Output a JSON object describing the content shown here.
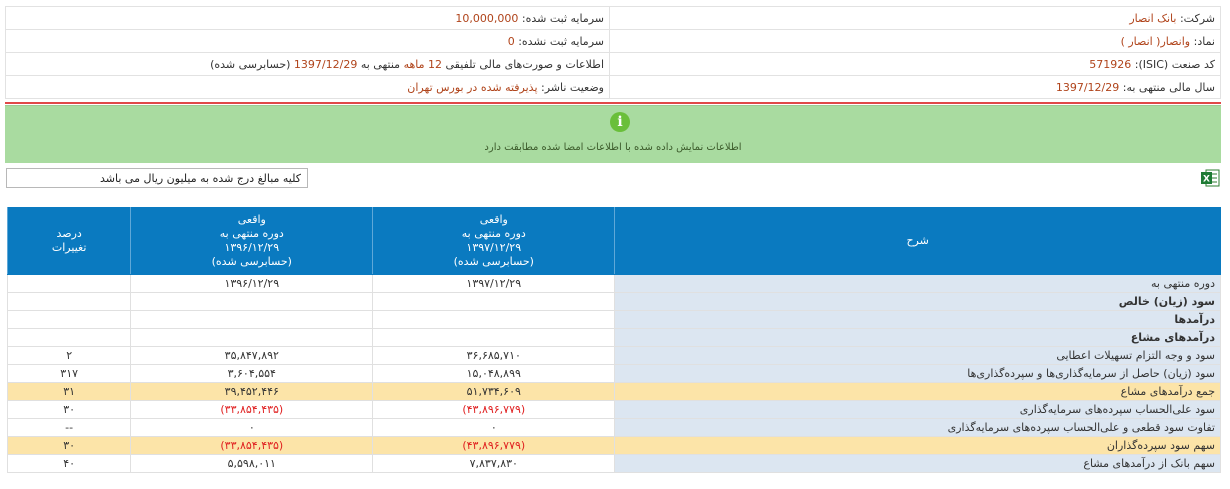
{
  "info": {
    "company_label": "شرکت:",
    "company_value": "بانک انصار",
    "capital_reg_label": "سرمایه ثبت شده:",
    "capital_reg_value": "10,000,000",
    "symbol_label": "نماد:",
    "symbol_value": "وانصار( انصار )",
    "capital_unreg_label": "سرمایه ثبت نشده:",
    "capital_unreg_value": "0",
    "isic_label": "کد صنعت (ISIC):",
    "isic_value": "571926",
    "report_label": "اطلاعات و صورت‌های مالی تلفیقی",
    "report_months": "12 ماهه",
    "report_mid": "منتهی به",
    "report_date": "1397/12/29",
    "report_status": "(حسابرسی شده)",
    "fiscal_label": "سال مالی منتهی به:",
    "fiscal_value": "1397/12/29",
    "publisher_label": "وضعیت ناشر:",
    "publisher_value": "پذیرفته شده در بورس تهران"
  },
  "notice": {
    "icon": "info-icon",
    "text": "اطلاعات نمایش داده شده با اطلاعات امضا شده مطابقت دارد"
  },
  "note": "کلیه مبالغ درج شده به میلیون ریال می باشد",
  "excel_icon": "excel-export-icon",
  "colors": {
    "header_blue": "#0a7ac0",
    "highlight": "#fce4a8",
    "desc_bg": "#dce6f1",
    "negative": "#e02020",
    "notice_green": "#a9dba0"
  },
  "table": {
    "headers": {
      "desc": "شرح",
      "cur_l1": "واقعی",
      "cur_l2": "دوره منتهی به",
      "cur_l3": "۱۳۹۷/۱۲/۲۹",
      "cur_l4": "(حسابرسی شده)",
      "prev_l1": "واقعی",
      "prev_l2": "دوره منتهی به",
      "prev_l3": "۱۳۹۶/۱۲/۲۹",
      "prev_l4": "(حسابرسی شده)",
      "chg_l1": "درصد",
      "chg_l2": "تغییرات"
    },
    "rows": [
      {
        "desc": "دوره منتهی به",
        "cur": "۱۳۹۷/۱۲/۲۹",
        "prev": "۱۳۹۶/۱۲/۲۹",
        "chg": "",
        "bold": false,
        "hl": false,
        "neg": false
      },
      {
        "desc": "سود (زیان) خالص",
        "cur": "",
        "prev": "",
        "chg": "",
        "bold": true,
        "hl": false,
        "neg": false
      },
      {
        "desc": "درآمدها",
        "cur": "",
        "prev": "",
        "chg": "",
        "bold": true,
        "hl": false,
        "neg": false
      },
      {
        "desc": "درآمدهای مشاع",
        "cur": "",
        "prev": "",
        "chg": "",
        "bold": true,
        "hl": false,
        "neg": false
      },
      {
        "desc": "سود و وجه التزام تسهیلات اعطایی",
        "cur": "۳۶,۶۸۵,۷۱۰",
        "prev": "۳۵,۸۴۷,۸۹۲",
        "chg": "۲",
        "bold": false,
        "hl": false,
        "neg": false
      },
      {
        "desc": "سود (زیان) حاصل از سرمایه‌گذاری‌ها و سپرده‌گذاری‌ها",
        "cur": "۱۵,۰۴۸,۸۹۹",
        "prev": "۳,۶۰۴,۵۵۴",
        "chg": "۳۱۷",
        "bold": false,
        "hl": false,
        "neg": false
      },
      {
        "desc": "جمع درآمدهای مشاع",
        "cur": "۵۱,۷۳۴,۶۰۹",
        "prev": "۳۹,۴۵۲,۴۴۶",
        "chg": "۳۱",
        "bold": false,
        "hl": true,
        "neg": false
      },
      {
        "desc": "سود علی‌الحساب سپرده‌های سرمایه‌گذاری",
        "cur": "(۴۳,۸۹۶,۷۷۹)",
        "prev": "(۳۳,۸۵۴,۴۳۵)",
        "chg": "۳۰",
        "bold": false,
        "hl": false,
        "neg": true
      },
      {
        "desc": "تفاوت سود قطعی و علی‌الحساب سپرده‌های سرمایه‌گذاری",
        "cur": "۰",
        "prev": "۰",
        "chg": "--",
        "bold": false,
        "hl": false,
        "neg": false
      },
      {
        "desc": "سهم سود سپرده‌گذاران",
        "cur": "(۴۳,۸۹۶,۷۷۹)",
        "prev": "(۳۳,۸۵۴,۴۳۵)",
        "chg": "۳۰",
        "bold": false,
        "hl": true,
        "neg": true
      },
      {
        "desc": "سهم بانک از درآمدهای مشاع",
        "cur": "۷,۸۳۷,۸۳۰",
        "prev": "۵,۵۹۸,۰۱۱",
        "chg": "۴۰",
        "bold": false,
        "hl": false,
        "neg": false
      }
    ]
  }
}
